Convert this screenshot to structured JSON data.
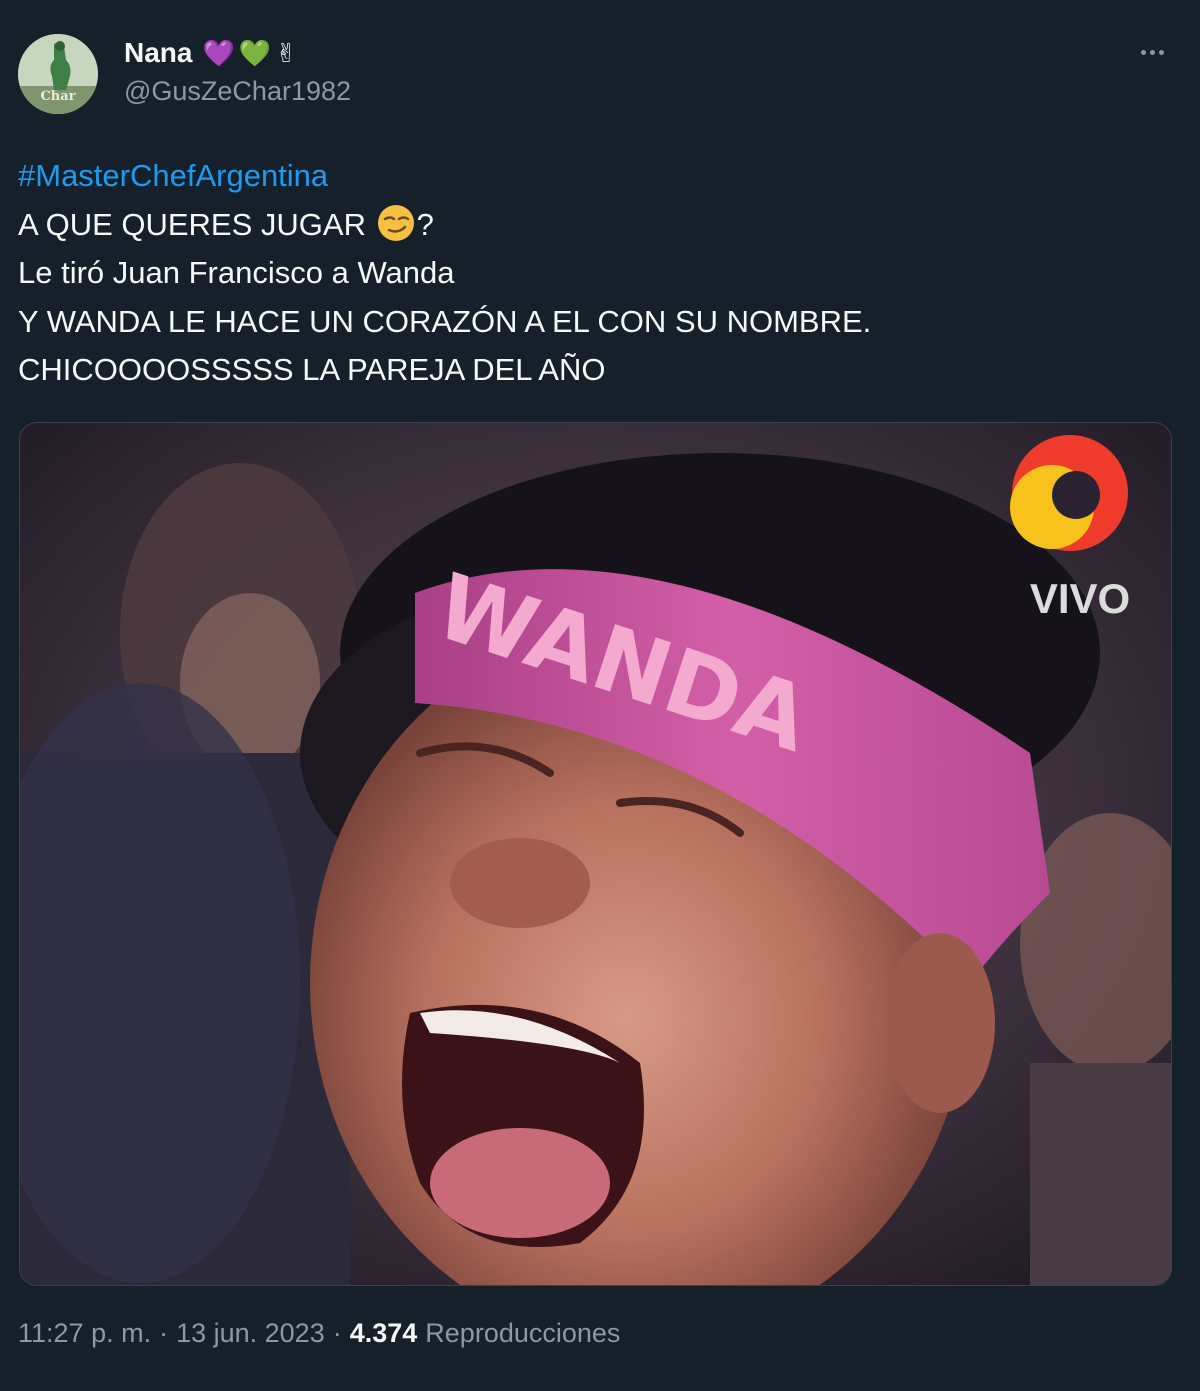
{
  "author": {
    "display_name": "Nana",
    "badges": [
      "💜",
      "💚",
      "✌"
    ],
    "handle": "@GusZeChar1982",
    "avatar_text": "Char"
  },
  "tweet": {
    "hashtag": "#MasterChefArgentina",
    "line1_text": "A QUE QUERES JUGAR ",
    "line1_emoji": "smirking-face-icon",
    "line1_suffix": "?",
    "line2": "Le tiró Juan Francisco a Wanda",
    "line3": "Y WANDA LE HACE UN CORAZÓN A EL CON SU NOMBRE.",
    "line4": "CHICOOOOSSSSS LA PAREJA DEL AÑO"
  },
  "media": {
    "headband_text": "WANDA",
    "channel_badge": "VIVO"
  },
  "meta": {
    "time": "11:27 p. m.",
    "separator": "·",
    "date": "13 jun. 2023",
    "views": "4.374",
    "views_label": "Reproducciones"
  },
  "colors": {
    "background": "#15202b",
    "hashtag": "#1d9bf0",
    "secondary_text": "#8b98a5",
    "headband": "#c6509a"
  }
}
